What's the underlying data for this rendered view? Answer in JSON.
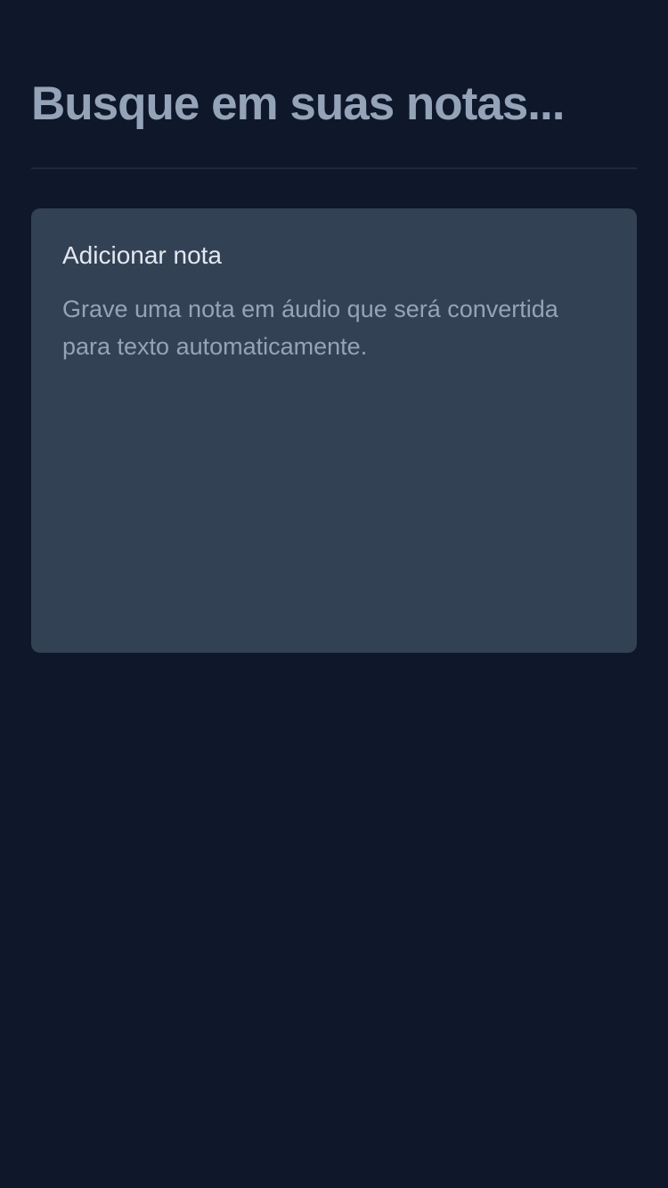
{
  "search": {
    "placeholder": "Busque em suas notas..."
  },
  "add_note_card": {
    "title": "Adicionar nota",
    "description": "Grave uma nota em áudio que será convertida para texto automaticamente."
  },
  "colors": {
    "background": "#0f172a",
    "card_background": "#334155",
    "divider": "#1e293b",
    "title_text": "#e2e8f0",
    "muted_text": "#94a3b8"
  }
}
